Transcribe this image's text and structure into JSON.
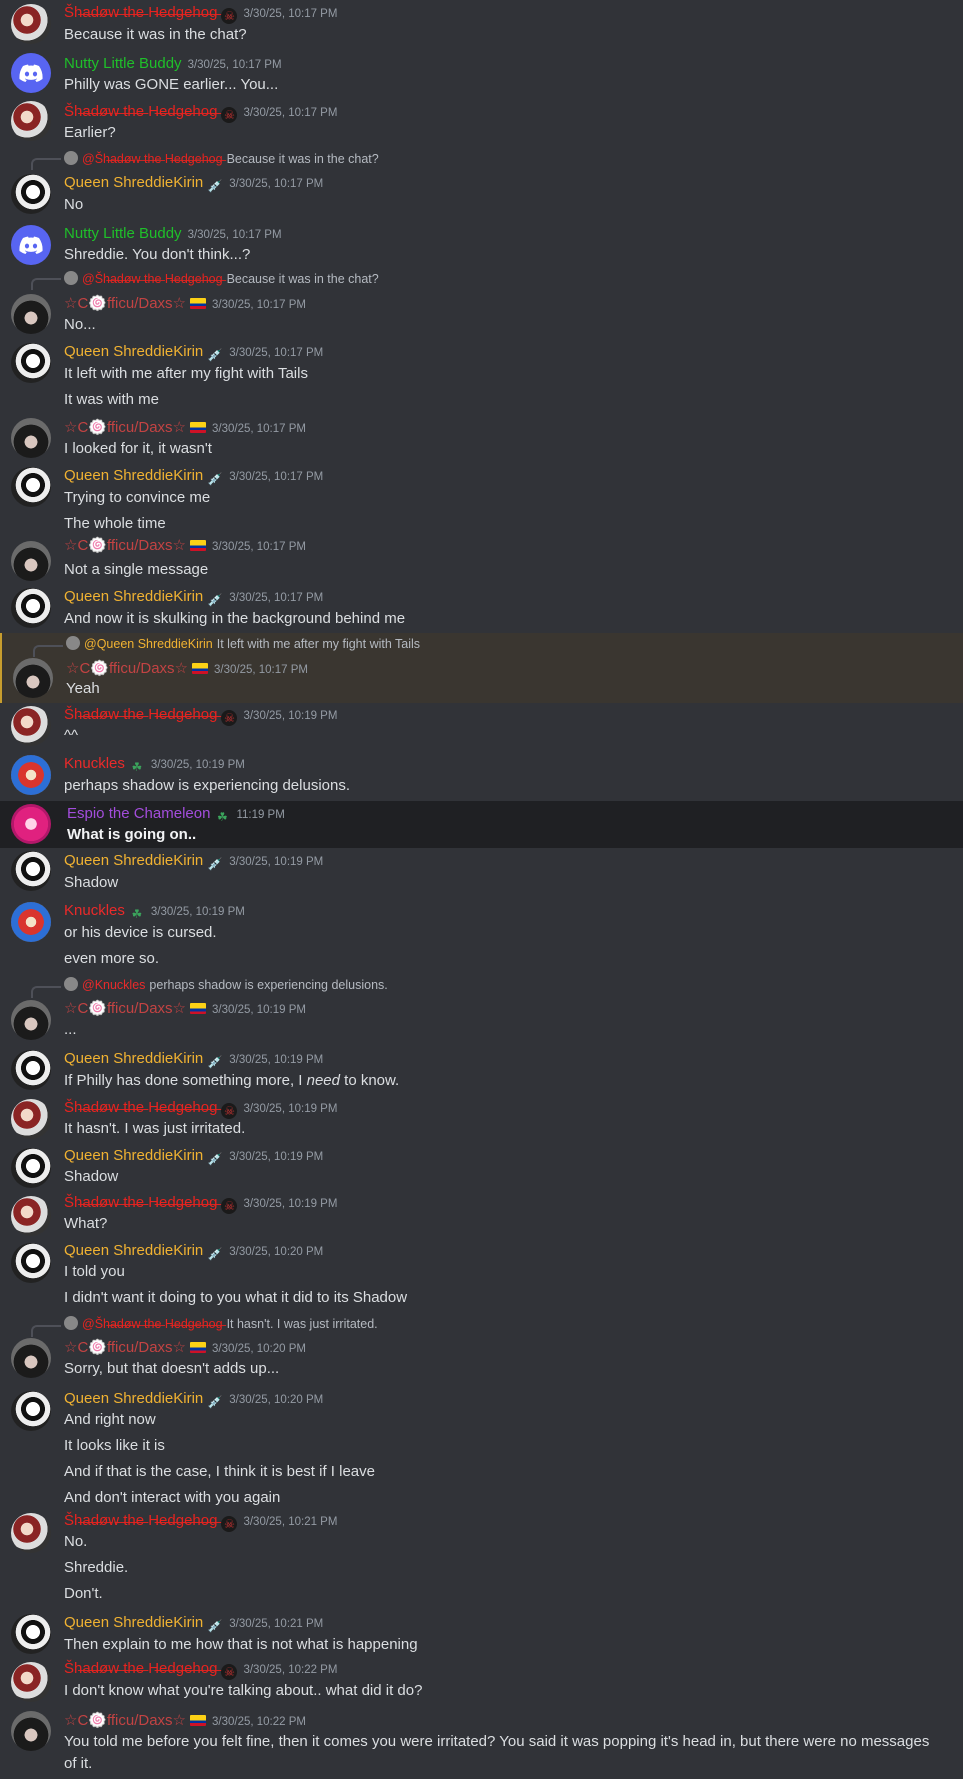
{
  "users": {
    "shadow": "Šh̶a̶d̶ø̶w̶ t̶h̶e̶ H̶e̶d̶g̶e̶h̶o̶g̶",
    "nutty": "Nutty Little Buddy",
    "queen": "Queen ShreddieKirin",
    "daxs": "☆C🍥fficu/Daxs☆",
    "knuckles": "Knuckles",
    "espio": "Espio the Chameleon"
  },
  "colors": {
    "background": "#313338",
    "shadow": "#e8231f",
    "nutty": "#1fbf2a",
    "queen": "#f0b232",
    "daxs": "#c24343",
    "knuckles": "#ea2a2a",
    "espio": "#a34ddc",
    "highlight": "#3a3630"
  },
  "messages": [
    {
      "author": "shadow",
      "time": "3/30/25, 10:17 PM",
      "lines": [
        "Because it was in the chat?"
      ]
    },
    {
      "author": "nutty",
      "time": "3/30/25, 10:17 PM",
      "lines": [
        "Philly was GONE earlier... You..."
      ]
    },
    {
      "author": "shadow",
      "time": "3/30/25, 10:17 PM",
      "lines": [
        "Earlier?"
      ]
    },
    {
      "author": "queen",
      "time": "3/30/25, 10:17 PM",
      "reply": {
        "name": "@Šh̶a̶d̶ø̶w̶ t̶h̶e̶ H̶e̶d̶g̶e̶h̶o̶g̶",
        "text": "Because it was in the chat?"
      },
      "lines": [
        "No"
      ]
    },
    {
      "author": "nutty",
      "time": "3/30/25, 10:17 PM",
      "lines": [
        "Shreddie. You don't think...?"
      ]
    },
    {
      "author": "daxs",
      "time": "3/30/25, 10:17 PM",
      "reply": {
        "name": "@Šh̶a̶d̶ø̶w̶ t̶h̶e̶ H̶e̶d̶g̶e̶h̶o̶g̶",
        "text": "Because it was in the chat?"
      },
      "lines": [
        "No..."
      ]
    },
    {
      "author": "queen",
      "time": "3/30/25, 10:17 PM",
      "lines": [
        "It left with me after my fight with Tails",
        "It was with me"
      ]
    },
    {
      "author": "daxs",
      "time": "3/30/25, 10:17 PM",
      "lines": [
        "I looked for it, it wasn't"
      ]
    },
    {
      "author": "queen",
      "time": "3/30/25, 10:17 PM",
      "lines": [
        "Trying to convince me",
        "The whole time"
      ]
    },
    {
      "author": "daxs",
      "time": "3/30/25, 10:17 PM",
      "lines": [
        "Not a single message"
      ]
    },
    {
      "author": "queen",
      "time": "3/30/25, 10:17 PM",
      "lines": [
        "And now it is skulking in the background behind me"
      ]
    },
    {
      "author": "daxs",
      "time": "3/30/25, 10:17 PM",
      "reply": {
        "name": "@Queen ShreddieKirin",
        "text": "It left with me after my fight with Tails"
      },
      "lines": [
        "Yeah"
      ]
    },
    {
      "author": "shadow",
      "time": "3/30/25, 10:19 PM",
      "lines": [
        "^^"
      ]
    },
    {
      "author": "knuckles",
      "time": "3/30/25, 10:19 PM",
      "lines": [
        "perhaps shadow is experiencing delusions."
      ]
    },
    {
      "author": "espio",
      "time": "11:19 PM",
      "lines": [
        "What is going on.."
      ]
    },
    {
      "author": "queen",
      "time": "3/30/25, 10:19 PM",
      "lines": [
        "Shadow"
      ]
    },
    {
      "author": "knuckles",
      "time": "3/30/25, 10:19 PM",
      "lines": [
        "or his device is cursed.",
        "even more so."
      ]
    },
    {
      "author": "daxs",
      "time": "3/30/25, 10:19 PM",
      "reply": {
        "name": "@Knuckles",
        "text": "perhaps shadow is experiencing delusions."
      },
      "lines": [
        "..."
      ]
    },
    {
      "author": "queen",
      "time": "3/30/25, 10:19 PM",
      "lines": [
        "If Philly has done something more, I ",
        "need",
        " to know."
      ]
    },
    {
      "author": "shadow",
      "time": "3/30/25, 10:19 PM",
      "lines": [
        "It hasn't. I was just irritated."
      ]
    },
    {
      "author": "queen",
      "time": "3/30/25, 10:19 PM",
      "lines": [
        "Shadow"
      ]
    },
    {
      "author": "shadow",
      "time": "3/30/25, 10:19 PM",
      "lines": [
        "What?"
      ]
    },
    {
      "author": "queen",
      "time": "3/30/25, 10:20 PM",
      "lines": [
        "I told you",
        "I didn't want it doing to you what it did to its Shadow"
      ]
    },
    {
      "author": "daxs",
      "time": "3/30/25, 10:20 PM",
      "reply": {
        "name": "@Šh̶a̶d̶ø̶w̶ t̶h̶e̶ H̶e̶d̶g̶e̶h̶o̶g̶",
        "text": "It hasn't. I was just irritated."
      },
      "lines": [
        "Sorry, but that doesn't adds up..."
      ]
    },
    {
      "author": "queen",
      "time": "3/30/25, 10:20 PM",
      "lines": [
        "And right now",
        "It looks like it is",
        "And if that is the case, I think it is best if I leave",
        "And don't interact with you again"
      ]
    },
    {
      "author": "shadow",
      "time": "3/30/25, 10:21 PM",
      "lines": [
        "No.",
        "Shreddie.",
        "Don't."
      ]
    },
    {
      "author": "queen",
      "time": "3/30/25, 10:21 PM",
      "lines": [
        "Then explain to me how that is not what is happening"
      ]
    },
    {
      "author": "shadow",
      "time": "3/30/25, 10:22 PM",
      "lines": [
        "I don't know what you're talking about.. what did it do?"
      ]
    },
    {
      "author": "daxs",
      "time": "3/30/25, 10:22 PM",
      "lines": [
        "You told me before you felt fine, then it comes you were irritated? You said it was popping it's head in, but there were no messages of it."
      ]
    }
  ]
}
